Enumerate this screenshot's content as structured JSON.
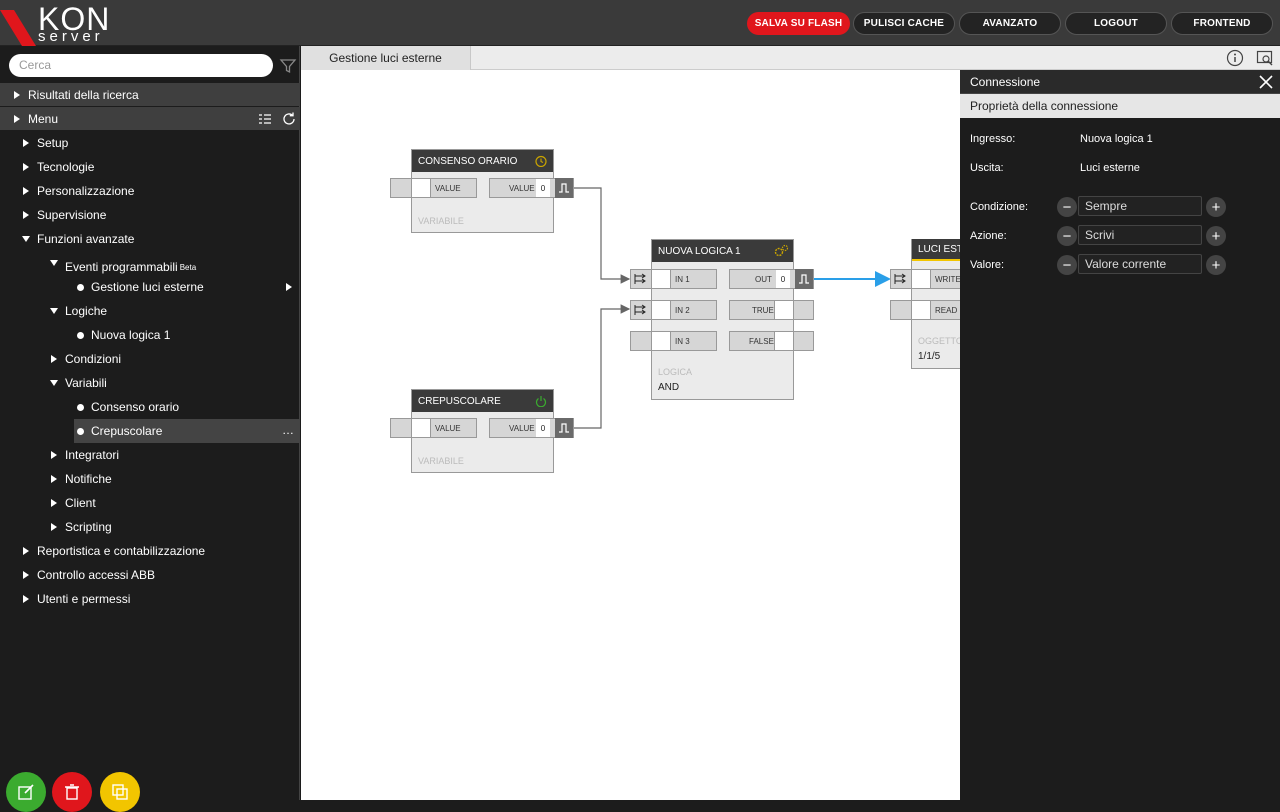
{
  "logo": {
    "brand": "KON",
    "subtitle": "server"
  },
  "topbar": {
    "buttons": [
      "SALVA SU FLASH",
      "PULISCI CACHE",
      "AVANZATO",
      "LOGOUT",
      "FRONTEND"
    ],
    "accent_color": "#e0161c"
  },
  "sidebar": {
    "search_placeholder": "Cerca",
    "results_label": "Risultati della ricerca",
    "menu_label": "Menu",
    "items": [
      {
        "label": "Setup"
      },
      {
        "label": "Tecnologie"
      },
      {
        "label": "Personalizzazione"
      },
      {
        "label": "Supervisione"
      },
      {
        "label": "Funzioni avanzate"
      },
      {
        "label": "Eventi programmabili",
        "badge": "Beta"
      },
      {
        "label": "Gestione luci esterne"
      },
      {
        "label": "Logiche"
      },
      {
        "label": "Nuova logica 1"
      },
      {
        "label": "Condizioni"
      },
      {
        "label": "Variabili"
      },
      {
        "label": "Consenso orario"
      },
      {
        "label": "Crepuscolare"
      },
      {
        "label": "Integratori"
      },
      {
        "label": "Notifiche"
      },
      {
        "label": "Client"
      },
      {
        "label": "Scripting"
      },
      {
        "label": "Reportistica e contabilizzazione"
      },
      {
        "label": "Controllo accessi ABB"
      },
      {
        "label": "Utenti e permessi"
      }
    ],
    "more_label": "…",
    "action_colors": {
      "edit": "#3bab2f",
      "delete": "#e0161c",
      "copy": "#f2c500"
    }
  },
  "tab": {
    "label": "Gestione luci esterne"
  },
  "canvas": {
    "nodes": {
      "consenso": {
        "title": "CONSENSO ORARIO",
        "in_label": "VALUE",
        "out_label": "VALUE",
        "out_value": "0",
        "sub": "VARIABILE"
      },
      "crepuscolare": {
        "title": "CREPUSCOLARE",
        "in_label": "VALUE",
        "out_label": "VALUE",
        "out_value": "0",
        "sub": "VARIABILE"
      },
      "logica": {
        "title": "NUOVA LOGICA 1",
        "in1": "IN 1",
        "in2": "IN 2",
        "in3": "IN 3",
        "out": "OUT",
        "out_value": "0",
        "true_label": "TRUE",
        "false_label": "FALSE",
        "sub": "LOGICA",
        "value": "AND"
      },
      "luci": {
        "title": "LUCI EST",
        "write": "WRITE",
        "read": "READ",
        "sub": "OGGETTO",
        "value": "1/1/5"
      }
    }
  },
  "panel": {
    "title": "Connessione",
    "subtitle": "Proprietà della connessione",
    "ingresso_label": "Ingresso:",
    "ingresso_value": "Nuova logica 1",
    "uscita_label": "Uscita:",
    "uscita_value": "Luci esterne",
    "condizione_label": "Condizione:",
    "condizione_value": "Sempre",
    "azione_label": "Azione:",
    "azione_value": "Scrivi",
    "valore_label": "Valore:",
    "valore_value": "Valore corrente"
  }
}
